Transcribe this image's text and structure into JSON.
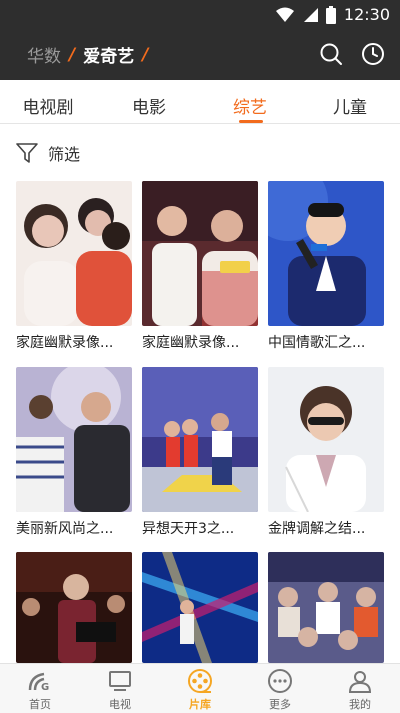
{
  "status_bar": {
    "time": "12:30"
  },
  "header": {
    "brand_primary": "华数",
    "brand_secondary": "爱奇艺",
    "slash": "/"
  },
  "tabs": [
    {
      "label": "电视剧",
      "active": false
    },
    {
      "label": "电影",
      "active": false
    },
    {
      "label": "综艺",
      "active": true
    },
    {
      "label": "儿童",
      "active": false
    }
  ],
  "filter": {
    "label": "筛选"
  },
  "cards": [
    {
      "title": "家庭幽默录像...",
      "palette": [
        "#e8c6b8",
        "#c2a497",
        "#f7f2ef"
      ]
    },
    {
      "title": "家庭幽默录像...",
      "palette": [
        "#3a2a2a",
        "#d9d0c9",
        "#c23a2e"
      ]
    },
    {
      "title": "中国情歌汇之...",
      "palette": [
        "#2a4ab8",
        "#5f86e0",
        "#1d2e7a"
      ]
    },
    {
      "title": "美丽新风尚之...",
      "palette": [
        "#a9a5c6",
        "#6f5c7e",
        "#2e2a3a"
      ]
    },
    {
      "title": "异想天开3之...",
      "palette": [
        "#2b2a6e",
        "#6b6fc6",
        "#d84a3a"
      ]
    },
    {
      "title": "金牌调解之结...",
      "palette": [
        "#e6e8ec",
        "#cfd3da",
        "#2c2c2c"
      ]
    },
    {
      "title": "",
      "palette": [
        "#3a1a14",
        "#7a3324",
        "#b99b8a"
      ]
    },
    {
      "title": "",
      "palette": [
        "#0e2b86",
        "#38a0e8",
        "#c81f6d"
      ]
    },
    {
      "title": "",
      "palette": [
        "#4c4d7a",
        "#d6b4a3",
        "#e8e0d7"
      ]
    }
  ],
  "bottom_nav": [
    {
      "label": "首页",
      "icon": "home-icon",
      "active": false
    },
    {
      "label": "电视",
      "icon": "tv-icon",
      "active": false
    },
    {
      "label": "片库",
      "icon": "film-reel-icon",
      "active": true
    },
    {
      "label": "更多",
      "icon": "more-icon",
      "active": false
    },
    {
      "label": "我的",
      "icon": "person-icon",
      "active": false
    }
  ],
  "colors": {
    "accent": "#f26b1d",
    "nav_active": "#f5a623",
    "header_bg": "#2e2e2e"
  }
}
